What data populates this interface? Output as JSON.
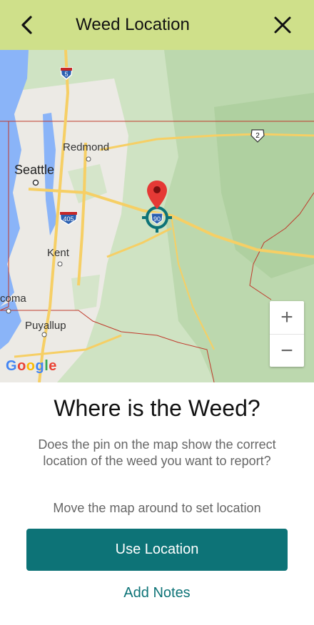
{
  "header": {
    "title": "Weed Location",
    "back_icon": "chevron-left-icon",
    "close_icon": "close-icon"
  },
  "map": {
    "places": {
      "seattle": "Seattle",
      "redmond": "Redmond",
      "kent": "Kent",
      "tacoma": "coma",
      "puyallup": "Puyallup"
    },
    "highways": {
      "i5": "5",
      "i405": "405",
      "i90": "90",
      "us2": "2"
    },
    "zoom_in_label": "+",
    "zoom_out_label": "−",
    "attribution": "Google",
    "colors": {
      "land": "#cfe3c3",
      "water": "#8ab4f8",
      "urban": "#eceae5",
      "highway": "#f6cf65",
      "boundary": "#c0392b",
      "pin": "#e53935",
      "target": "#0d7377"
    }
  },
  "main": {
    "question": "Where is the Weed?",
    "description": "Does the pin on the map show the correct location of the weed you want to report?",
    "hint": "Move the map around to set location",
    "use_location_label": "Use Location",
    "add_notes_label": "Add Notes"
  },
  "theme": {
    "header_bg": "#cfe08a",
    "primary": "#0d7377"
  }
}
